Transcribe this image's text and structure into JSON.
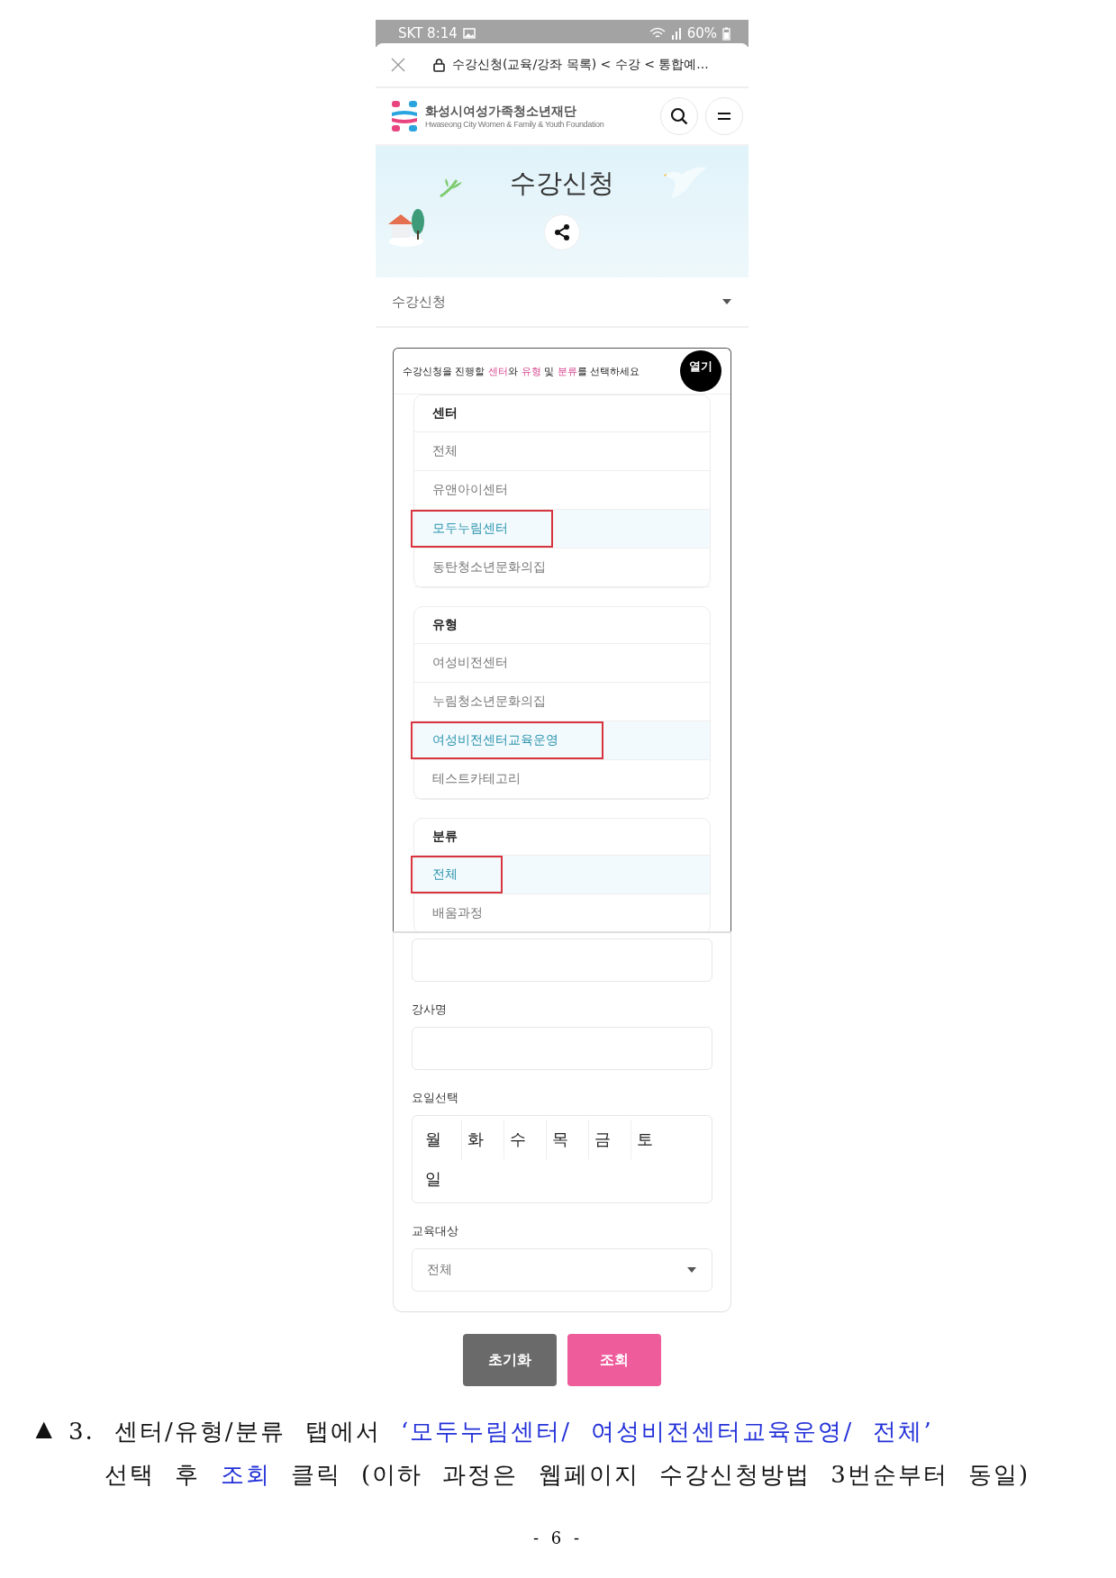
{
  "status_bar": {
    "carrier_time": "SKT 8:14",
    "battery": "60%"
  },
  "browser_bar": {
    "title": "수강신청(교육/강좌 목록) < 수강 < 통합예..."
  },
  "site_header": {
    "org_name": "화성시여성가족청소년재단",
    "org_name_en": "Hwaseong City Women & Family & Youth Foundation"
  },
  "banner": {
    "title": "수강신청"
  },
  "page_select": {
    "value": "수강신청"
  },
  "filter_panel": {
    "instruction": [
      {
        "text": "수강신청을 진행할 ",
        "highlight": false
      },
      {
        "text": "센터",
        "highlight": true
      },
      {
        "text": "와 ",
        "highlight": false
      },
      {
        "text": "유형",
        "highlight": true
      },
      {
        "text": " 및 ",
        "highlight": false
      },
      {
        "text": "분류",
        "highlight": true
      },
      {
        "text": "를 선택하세요",
        "highlight": false
      }
    ],
    "toggle": "열기",
    "groups": [
      {
        "title": "센터",
        "items": [
          {
            "label": "전체",
            "selected": false,
            "annotated": false
          },
          {
            "label": "유앤아이센터",
            "selected": false,
            "annotated": false
          },
          {
            "label": "모두누림센터",
            "selected": true,
            "annotated": true
          },
          {
            "label": "동탄청소년문화의집",
            "selected": false,
            "annotated": false
          }
        ]
      },
      {
        "title": "유형",
        "items": [
          {
            "label": "여성비전센터",
            "selected": false,
            "annotated": false
          },
          {
            "label": "누림청소년문화의집",
            "selected": false,
            "annotated": false
          },
          {
            "label": "여성비전센터교육운영",
            "selected": true,
            "annotated": true
          },
          {
            "label": "테스트카테고리",
            "selected": false,
            "annotated": false
          }
        ]
      },
      {
        "title": "분류",
        "items": [
          {
            "label": "전체",
            "selected": true,
            "annotated": true
          },
          {
            "label": "배움과정",
            "selected": false,
            "annotated": false
          }
        ]
      }
    ],
    "fields": [
      {
        "kind": "input"
      },
      {
        "kind": "input",
        "label": "강사명"
      },
      {
        "kind": "days",
        "label": "요일선택",
        "days": [
          "월",
          "화",
          "수",
          "목",
          "금",
          "토",
          "일"
        ]
      },
      {
        "kind": "select",
        "label": "교육대상",
        "value": "전체"
      }
    ]
  },
  "buttons": [
    {
      "label": "초기화",
      "kind": "reset"
    },
    {
      "label": "조회",
      "kind": "search"
    }
  ],
  "caption": {
    "marker": "▲",
    "lines": [
      [
        {
          "text": "3. 센터/유형/분류 탭에서 ",
          "highlight": false
        },
        {
          "text": "‘모두누림센터/ 여성비전센터교육운영/ 전체’",
          "highlight": true
        }
      ],
      [
        {
          "text": "선택 후 ",
          "highlight": false
        },
        {
          "text": "조회",
          "highlight": true
        },
        {
          "text": " 클릭 (이하 과정은 웹페이지 수강신청방법 3번순부터 동일)",
          "highlight": false
        }
      ]
    ]
  },
  "page_number": "- 6 -"
}
